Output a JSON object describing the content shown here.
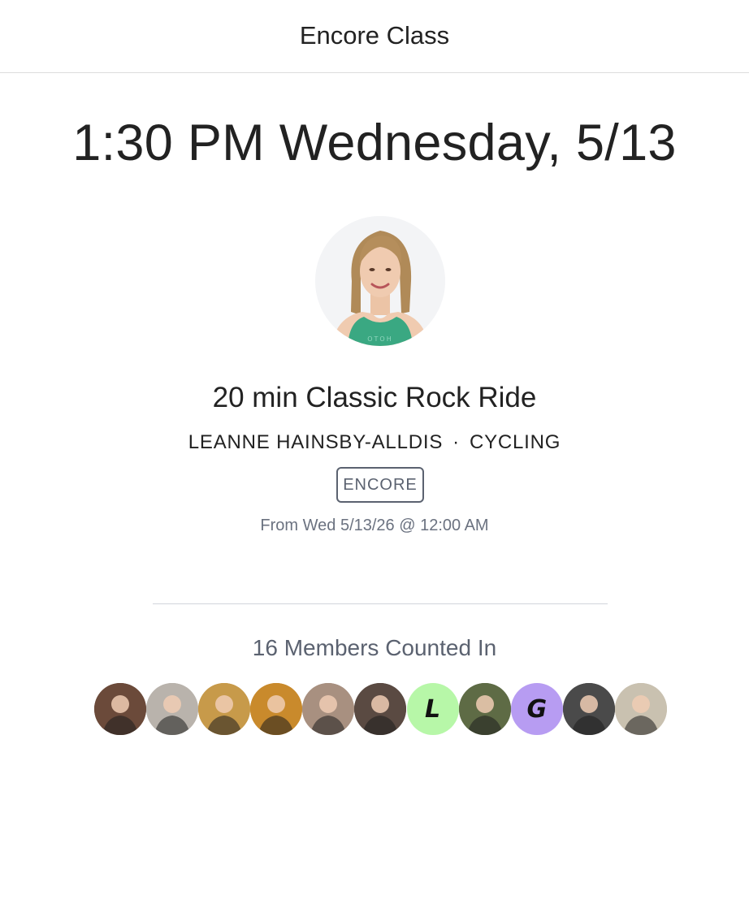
{
  "header": {
    "title": "Encore Class"
  },
  "schedule": {
    "date_time": "1:30 PM Wednesday, 5/13"
  },
  "class": {
    "title": "20 min Classic Rock Ride",
    "instructor": "LEANNE HAINSBY-ALLDIS",
    "separator": "·",
    "discipline": "CYCLING",
    "badge": "ENCORE",
    "availability": "From Wed 5/13/26 @ 12:00 AM"
  },
  "members": {
    "heading": "16 Members Counted In",
    "avatars": [
      {
        "kind": "photo",
        "bg": "#6b4a3a"
      },
      {
        "kind": "photo",
        "bg": "#b9b3ac"
      },
      {
        "kind": "photo",
        "bg": "#c79a4a"
      },
      {
        "kind": "photo",
        "bg": "#c98a2c"
      },
      {
        "kind": "photo",
        "bg": "#a89080"
      },
      {
        "kind": "photo",
        "bg": "#5a4a42"
      },
      {
        "kind": "letter",
        "letter": "L",
        "bg": "#b7f7a8"
      },
      {
        "kind": "photo",
        "bg": "#5e6b45"
      },
      {
        "kind": "letter",
        "letter": "G",
        "bg": "#b79cf2"
      },
      {
        "kind": "photo",
        "bg": "#4a4a4a"
      },
      {
        "kind": "photo",
        "bg": "#c9c1b0"
      }
    ]
  },
  "colors": {
    "text_primary": "#222222",
    "text_muted": "#6b7280",
    "badge_border": "#5b6270",
    "divider": "#d1d5db"
  }
}
